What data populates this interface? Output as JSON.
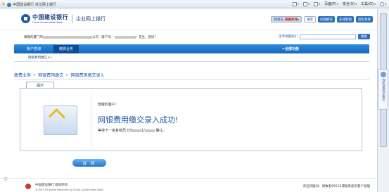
{
  "browser": {
    "tab_title": "中国建设银行 单位网上银行",
    "tools": [
      "页面(P)",
      "安全(S)",
      "工具(O)"
    ]
  },
  "header": {
    "logo_cn": "中国建设银行",
    "logo_en": "China Construction Bank",
    "subtitle": "企业网上银行",
    "nav": {
      "welcome_pill": "我想去",
      "mall": "善融商城",
      "confirm": "确定",
      "qa": "问题解答",
      "online_service": "在线客服",
      "logout": "退出系统"
    }
  },
  "userline": {
    "welcome_prefix": "尊敬的厦门市",
    "welcome_mid": "公司（客户号：",
    "welcome_suffix": "）先生，您好！",
    "search_label": "菜单调整指引",
    "search_button": "搜索"
  },
  "menubar": {
    "tabs": [
      "账户查询",
      "缴费业务"
    ],
    "all_functions": "全部功能"
  },
  "submenu": {
    "item": "网银费用缴交"
  },
  "breadcrumb": [
    "缴费业务",
    "网银费用缴交",
    "网银费用缴交录入"
  ],
  "panel": {
    "tab_label": "提示",
    "greeting": "尊敬的客户：",
    "message": "网银费用缴交录入成功!",
    "wait_prefix": "等待下一级复核员",
    "wait_code": "03",
    "wait_suffix": "确认。"
  },
  "return_button": "返 回",
  "footer": {
    "copyright": "中国建设银行 版权所有",
    "copyright_en": "©2007 All Rights Reserved by China Construction Bank",
    "hotline": "有任何疑问：请致电95533或联系您的客户经理"
  },
  "sidebar_tab": "我的常用功能栏",
  "left_glyph": "字",
  "colors": {
    "primary": "#1f5aa6",
    "menubar": "#1566b8",
    "accent": "#e8b400"
  }
}
